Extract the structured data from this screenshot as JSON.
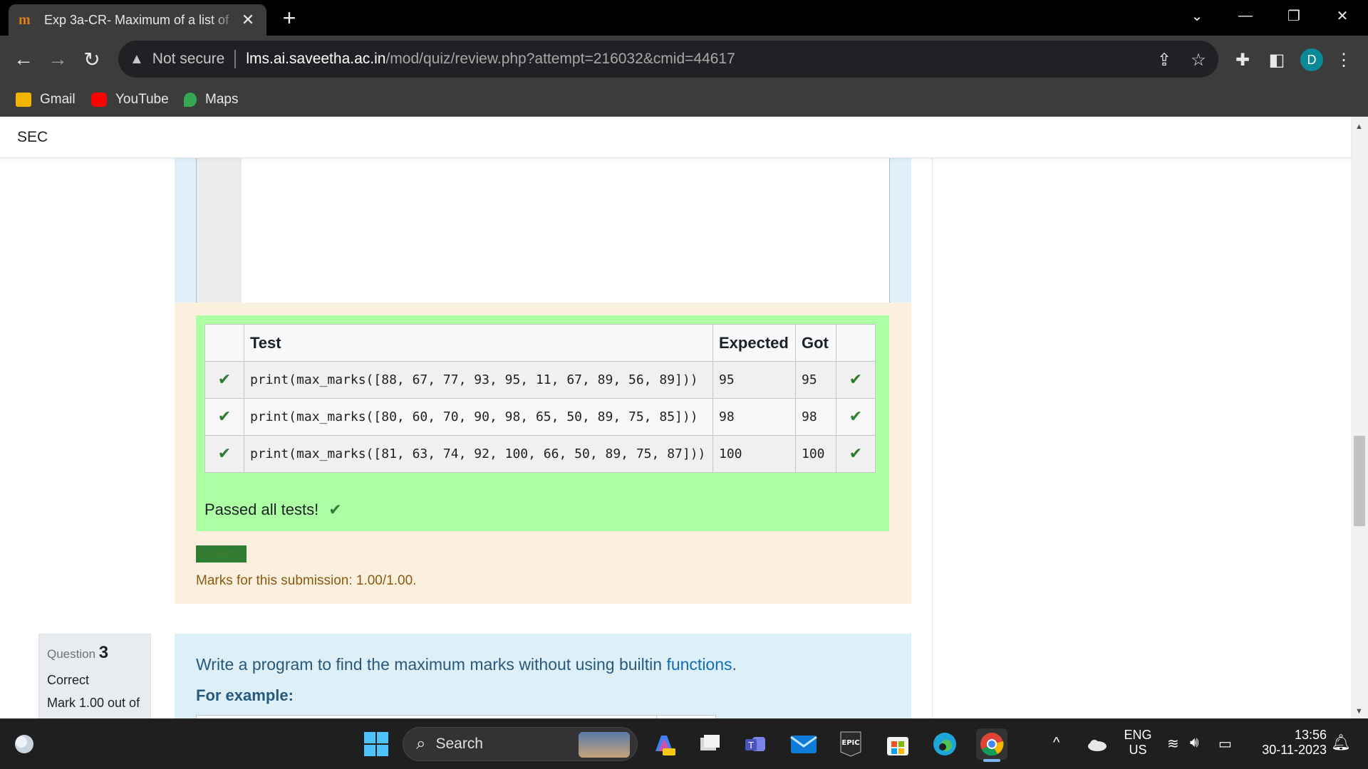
{
  "browser": {
    "tab_title": "Exp 3a-CR- Maximum of a list of",
    "tab_close": "✕",
    "new_tab": "+",
    "address": {
      "security_label": "Not secure",
      "domain": "lms.ai.saveetha.ac.in",
      "path": "/mod/quiz/review.php?attempt=216032&cmid=44617"
    },
    "profile_initial": "D",
    "bookmarks": [
      {
        "label": "Gmail",
        "icon": "gmail-icon",
        "color": "#f4b400"
      },
      {
        "label": "YouTube",
        "icon": "youtube-icon",
        "color": "#ff0000"
      },
      {
        "label": "Maps",
        "icon": "maps-icon",
        "color": "#34a853"
      }
    ]
  },
  "site": {
    "brand": "SEC"
  },
  "results": {
    "headers": {
      "test": "Test",
      "expected": "Expected",
      "got": "Got"
    },
    "rows": [
      {
        "test": "print(max_marks([88, 67, 77, 93, 95, 11, 67, 89, 56, 89]))",
        "expected": "95",
        "got": "95"
      },
      {
        "test": "print(max_marks([80, 60, 70, 90, 98, 65, 50, 89, 75, 85]))",
        "expected": "98",
        "got": "98"
      },
      {
        "test": "print(max_marks([81, 63, 74, 92, 100, 66, 50, 89, 75, 87]))",
        "expected": "100",
        "got": "100"
      }
    ],
    "passed_text": "Passed all tests!",
    "status_badge": "Correct",
    "marks_text": "Marks for this submission: 1.00/1.00."
  },
  "next_question": {
    "label": "Question",
    "number": "3",
    "state": "Correct",
    "mark": "Mark 1.00 out of",
    "prompt": "Write a program to find the maximum marks without using builtin ",
    "prompt_link": "functions",
    "prompt_end": ".",
    "for_example": "For example:"
  },
  "taskbar": {
    "search_placeholder": "Search",
    "lang_top": "ENG",
    "lang_bottom": "US",
    "time": "13:56",
    "date": "30-11-2023"
  },
  "colors": {
    "results_bg": "#adffa3",
    "feedback_bg": "#fbefde",
    "question_bg": "#def0f7",
    "correct_green": "#2e7d32"
  }
}
